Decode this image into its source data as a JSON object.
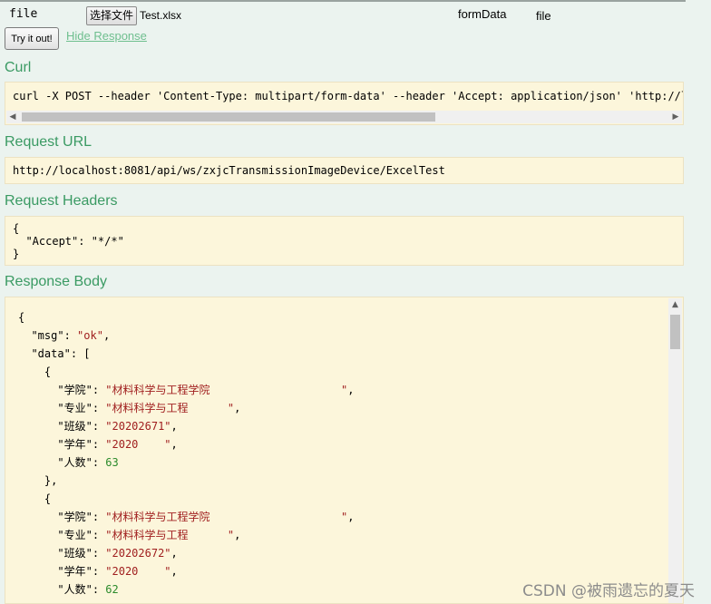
{
  "param": {
    "name": "file",
    "file_button_label": "选择文件",
    "file_name": "Test.xlsx",
    "param_type": "formData",
    "data_type": "file"
  },
  "actions": {
    "try_label": "Try it out!",
    "hide_label": "Hide Response"
  },
  "curl": {
    "title": "Curl",
    "command": "curl -X POST --header 'Content-Type: multipart/form-data' --header 'Accept: application/json' 'http://lo"
  },
  "request_url": {
    "title": "Request URL",
    "value": "http://localhost:8081/api/ws/zxjcTransmissionImageDevice/ExcelTest"
  },
  "request_headers": {
    "title": "Request Headers",
    "open": "{",
    "line": "  \"Accept\": \"*/*\"",
    "close": "}"
  },
  "response_body": {
    "title": "Response Body",
    "msg_key": "\"msg\"",
    "msg_value": "\"ok\"",
    "data_key": "\"data\"",
    "records": [
      {
        "k1": "\"学院\"",
        "v1": "\"材料科学与工程学院                    \"",
        "k2": "\"专业\"",
        "v2": "\"材料科学与工程      \"",
        "k3": "\"班级\"",
        "v3": "\"20202671\"",
        "k4": "\"学年\"",
        "v4": "\"2020    \"",
        "k5": "\"人数\"",
        "v5": "63"
      },
      {
        "k1": "\"学院\"",
        "v1": "\"材料科学与工程学院                    \"",
        "k2": "\"专业\"",
        "v2": "\"材料科学与工程      \"",
        "k3": "\"班级\"",
        "v3": "\"20202672\"",
        "k4": "\"学年\"",
        "v4": "\"2020    \"",
        "k5": "\"人数\"",
        "v5": "62"
      }
    ]
  },
  "watermark": "CSDN @被雨遗忘的夏天"
}
